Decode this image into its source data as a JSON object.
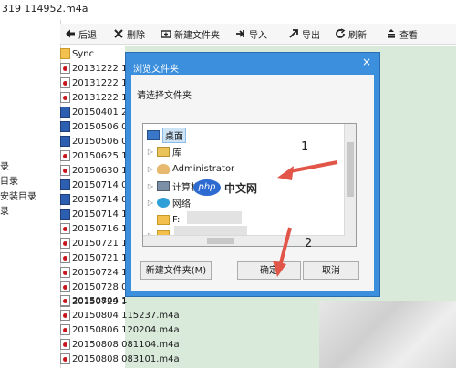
{
  "window": {
    "title_fragment": "319 114952.m4a"
  },
  "left_tree": {
    "items": [
      "录",
      "目录",
      "安装目录",
      "录"
    ]
  },
  "toolbar": {
    "back": "后退",
    "delete": "删除",
    "new_folder": "新建文件夹",
    "import": "导入",
    "export": "导出",
    "refresh": "刷新",
    "view": "查看"
  },
  "file_list": {
    "rows": [
      {
        "name": "Sync",
        "kind": "folder"
      },
      {
        "name": "20131222 1",
        "kind": "audio"
      },
      {
        "name": "20131222 1",
        "kind": "audio"
      },
      {
        "name": "20131222 1",
        "kind": "audio"
      },
      {
        "name": "20150401 2",
        "kind": "video"
      },
      {
        "name": "20150506 0",
        "kind": "video"
      },
      {
        "name": "20150506 0",
        "kind": "video"
      },
      {
        "name": "20150625 1",
        "kind": "audio"
      },
      {
        "name": "20150630 1",
        "kind": "audio"
      },
      {
        "name": "20150714 0",
        "kind": "video"
      },
      {
        "name": "20150714 0",
        "kind": "video"
      },
      {
        "name": "20150714 1",
        "kind": "video"
      },
      {
        "name": "20150716 1",
        "kind": "audio"
      },
      {
        "name": "20150721 1",
        "kind": "audio"
      },
      {
        "name": "20150721 1",
        "kind": "audio"
      },
      {
        "name": "20150724 1",
        "kind": "audio"
      },
      {
        "name": "20150728 0",
        "kind": "audio"
      },
      {
        "name": "20150729 1",
        "kind": "audio"
      }
    ],
    "bottom_rows": [
      "20150804 1",
      "20150804 115237.m4a",
      "20150806 120204.m4a",
      "20150808 081104.m4a",
      "20150808 083101.m4a"
    ]
  },
  "dialog": {
    "title": "浏览文件夹",
    "close": "×",
    "prompt": "请选择文件夹",
    "tree": {
      "desktop": "桌面",
      "library": "库",
      "user": "Administrator",
      "computer": "计算机",
      "network": "网络",
      "f_drive": "F:"
    },
    "new_folder_button": "新建文件夹(M)",
    "ok_button": "确定",
    "cancel_button": "取消"
  },
  "annotations": {
    "one": "1",
    "two": "2",
    "arrow_color": "#e2564a"
  },
  "watermark": {
    "badge": "php",
    "text": "中文网"
  },
  "colors": {
    "dialog_frame": "#3b8fdc",
    "green_pane": "#d9eadb",
    "selection": "#cde4f7"
  }
}
